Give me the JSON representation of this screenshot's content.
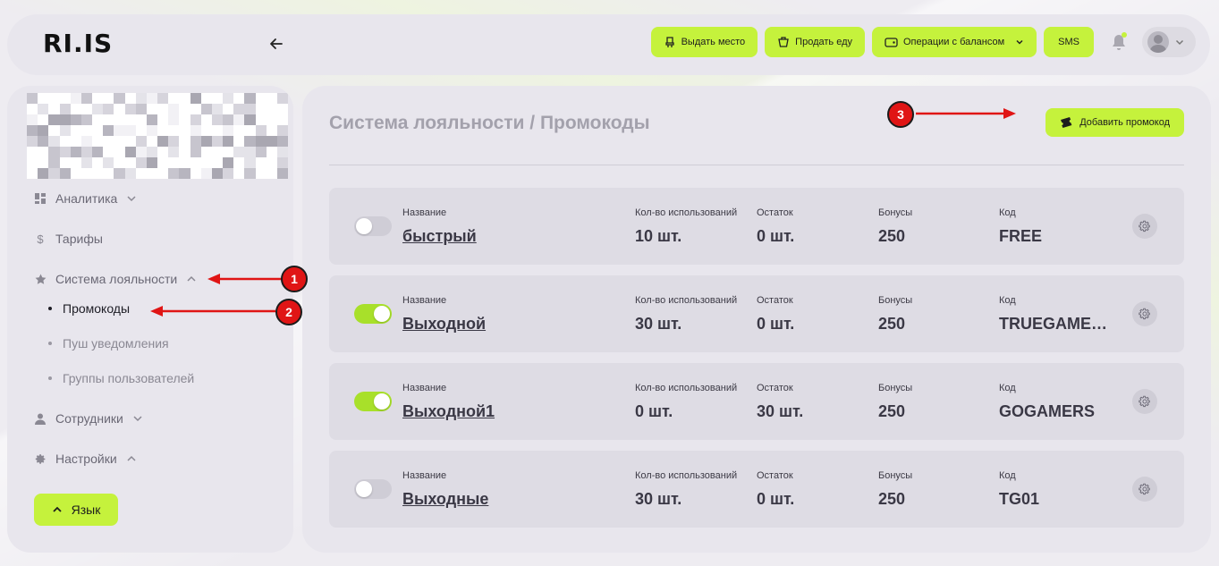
{
  "header": {
    "logo": "RI.IS",
    "buttons": [
      {
        "label": "Выдать место",
        "icon": "seat-icon"
      },
      {
        "label": "Продать еду",
        "icon": "food-icon"
      },
      {
        "label": "Операции с балансом",
        "icon": "wallet-icon"
      },
      {
        "label": "SMS"
      }
    ]
  },
  "sidebar": {
    "items": [
      {
        "label": "Аналитика",
        "icon": "dashboard-icon"
      },
      {
        "label": "Тарифы",
        "icon": "dollar-icon"
      },
      {
        "label": "Система лояльности",
        "icon": "star-icon"
      },
      {
        "label": "Сотрудники",
        "icon": "user-icon"
      },
      {
        "label": "Настройки",
        "icon": "gear-icon"
      }
    ],
    "subitems": [
      {
        "label": "Промокоды",
        "active": true
      },
      {
        "label": "Пуш уведомления",
        "active": false
      },
      {
        "label": "Группы пользователей",
        "active": false
      }
    ],
    "language_button": "Язык"
  },
  "main": {
    "title": "Система лояльности / Промокоды",
    "add_button": "Добавить промокод",
    "columns": {
      "name": "Название",
      "uses": "Кол-во использований",
      "remaining": "Остаток",
      "bonuses": "Бонусы",
      "code": "Код"
    },
    "promos": [
      {
        "enabled": false,
        "name": "быстрый",
        "uses": "10 шт.",
        "remaining": "0 шт.",
        "bonuses": "250",
        "code": "FREE"
      },
      {
        "enabled": true,
        "name": "Выходной",
        "uses": "30 шт.",
        "remaining": "0 шт.",
        "bonuses": "250",
        "code": "TRUEGAMER…"
      },
      {
        "enabled": true,
        "name": "Выходной1",
        "uses": "0 шт.",
        "remaining": "30 шт.",
        "bonuses": "250",
        "code": "GOGAMERS"
      },
      {
        "enabled": false,
        "name": "Выходные",
        "uses": "30 шт.",
        "remaining": "0 шт.",
        "bonuses": "250",
        "code": "TG01"
      }
    ]
  },
  "annotations": [
    "1",
    "2",
    "3"
  ],
  "colors": {
    "accent": "#c5f23c",
    "annotation": "#e01515"
  }
}
